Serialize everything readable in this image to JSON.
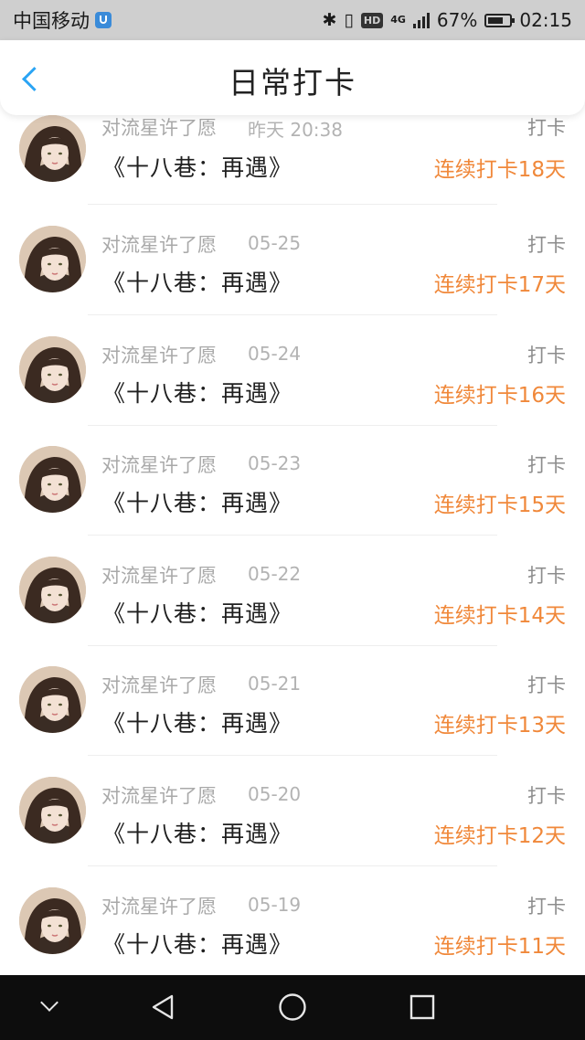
{
  "status_bar": {
    "carrier": "中国移动",
    "bluetooth_icon": "✱",
    "vibrate_icon": "▯",
    "hd": "HD",
    "network": "4G",
    "battery": "67%",
    "time": "02:15"
  },
  "header": {
    "title": "日常打卡",
    "back_icon": "chevron-left"
  },
  "colors": {
    "accent": "#2aa4f4",
    "streak": "#f0883a",
    "status_bar_bg": "#cfcfcf",
    "nav_bg": "#0d0d0d"
  },
  "entries": [
    {
      "author": "对流星许了愿",
      "date": "昨天 20:38",
      "book": "《十八巷：再遇》",
      "action": "打卡",
      "streak": "连续打卡18天"
    },
    {
      "author": "对流星许了愿",
      "date": "05-25",
      "book": "《十八巷：再遇》",
      "action": "打卡",
      "streak": "连续打卡17天"
    },
    {
      "author": "对流星许了愿",
      "date": "05-24",
      "book": "《十八巷：再遇》",
      "action": "打卡",
      "streak": "连续打卡16天"
    },
    {
      "author": "对流星许了愿",
      "date": "05-23",
      "book": "《十八巷：再遇》",
      "action": "打卡",
      "streak": "连续打卡15天"
    },
    {
      "author": "对流星许了愿",
      "date": "05-22",
      "book": "《十八巷：再遇》",
      "action": "打卡",
      "streak": "连续打卡14天"
    },
    {
      "author": "对流星许了愿",
      "date": "05-21",
      "book": "《十八巷：再遇》",
      "action": "打卡",
      "streak": "连续打卡13天"
    },
    {
      "author": "对流星许了愿",
      "date": "05-20",
      "book": "《十八巷：再遇》",
      "action": "打卡",
      "streak": "连续打卡12天"
    },
    {
      "author": "对流星许了愿",
      "date": "05-19",
      "book": "《十八巷：再遇》",
      "action": "打卡",
      "streak": "连续打卡11天"
    }
  ],
  "nav_bar": {
    "icons": [
      "chevron-down-icon",
      "back-triangle-icon",
      "home-circle-icon",
      "recent-square-icon"
    ]
  }
}
